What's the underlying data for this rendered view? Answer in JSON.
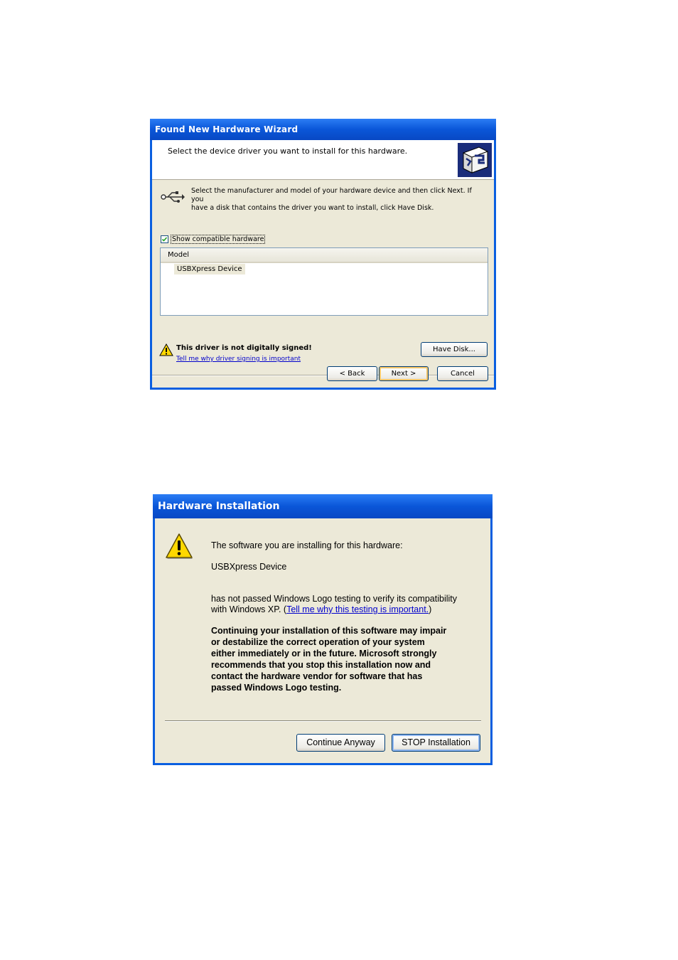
{
  "wizard": {
    "title": "Found New Hardware Wizard",
    "header_text": "Select the device driver you want to install for this hardware.",
    "instruction_line1": "Select the manufacturer and model of your hardware device and then click Next. If you",
    "instruction_line2": "have a disk that contains the driver you want to install, click Have Disk.",
    "checkbox_label": "Show compatible hardware",
    "checkbox_checked": true,
    "list_column_header": "Model",
    "list_items": [
      "USBXpress Device"
    ],
    "warning_text": "This driver is not digitally signed!",
    "warning_link": "Tell me why driver signing is important",
    "have_disk_label": "Have Disk...",
    "back_label": "< Back",
    "next_label": "Next >",
    "cancel_label": "Cancel",
    "icons": [
      "wizard-hardware-icon",
      "usb-icon",
      "warning-icon"
    ]
  },
  "install_dialog": {
    "title": "Hardware Installation",
    "line1": "The software you are installing for this hardware:",
    "device_name": "USBXpress Device",
    "line2": "has not passed Windows Logo testing to verify its compatibility",
    "line3_prefix": "with Windows XP. (",
    "line3_link": "Tell me why this testing is important.",
    "line3_suffix": ")",
    "bold_lines": [
      "Continuing your installation of this software may impair",
      "or destabilize the correct operation of your system",
      "either immediately or in the future. Microsoft strongly",
      "recommends that you stop this installation now and",
      "contact the hardware vendor for software that has",
      "passed Windows Logo testing."
    ],
    "continue_label": "Continue Anyway",
    "stop_label": "STOP Installation",
    "icons": [
      "warning-icon"
    ]
  },
  "colors": {
    "titlebar_blue": "#0a56d8",
    "dialog_face": "#ece9d8",
    "link_blue": "#0000cc"
  }
}
